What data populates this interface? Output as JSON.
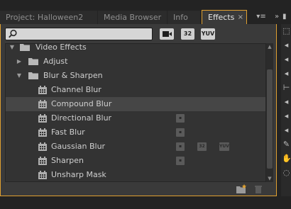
{
  "tabs": [
    {
      "label": "Project: Halloween2",
      "active": false
    },
    {
      "label": "Media Browser",
      "active": false
    },
    {
      "label": "Info",
      "active": false
    },
    {
      "label": "Effects",
      "active": true
    }
  ],
  "close_glyph": "×",
  "panel_menu_glyph": "▾≡",
  "overflow_glyph": "»",
  "search": {
    "value": "",
    "placeholder": ""
  },
  "filters": [
    {
      "label": "",
      "icon": "accelerated-effects-icon"
    },
    {
      "label": "32",
      "icon": "32-bit-color-icon"
    },
    {
      "label": "YUV",
      "icon": "yuv-effects-icon"
    }
  ],
  "tree": [
    {
      "label": "Video Effects",
      "kind": "folder",
      "level": 0,
      "expanded": true
    },
    {
      "label": "Adjust",
      "kind": "folder",
      "level": 1,
      "expanded": false
    },
    {
      "label": "Blur & Sharpen",
      "kind": "folder",
      "level": 1,
      "expanded": true
    },
    {
      "label": "Channel Blur",
      "kind": "effect",
      "level": 2,
      "badges": []
    },
    {
      "label": "Compound Blur",
      "kind": "effect",
      "level": 2,
      "badges": [],
      "selected": true
    },
    {
      "label": "Directional Blur",
      "kind": "effect",
      "level": 2,
      "badges": [
        "accelerated"
      ]
    },
    {
      "label": "Fast Blur",
      "kind": "effect",
      "level": 2,
      "badges": [
        "accelerated"
      ]
    },
    {
      "label": "Gaussian Blur",
      "kind": "effect",
      "level": 2,
      "badges": [
        "accelerated",
        "32",
        "YUV"
      ]
    },
    {
      "label": "Sharpen",
      "kind": "effect",
      "level": 2,
      "badges": [
        "accelerated"
      ]
    },
    {
      "label": "Unsharp Mask",
      "kind": "effect",
      "level": 2,
      "badges": []
    }
  ],
  "footer": {
    "new_bin_icon": "new-custom-bin-icon",
    "delete_icon": "trash-icon"
  },
  "colors": {
    "accent": "#e0a030",
    "panel": "#3a3a3a",
    "list": "#333333",
    "selected_row": "#464646"
  }
}
